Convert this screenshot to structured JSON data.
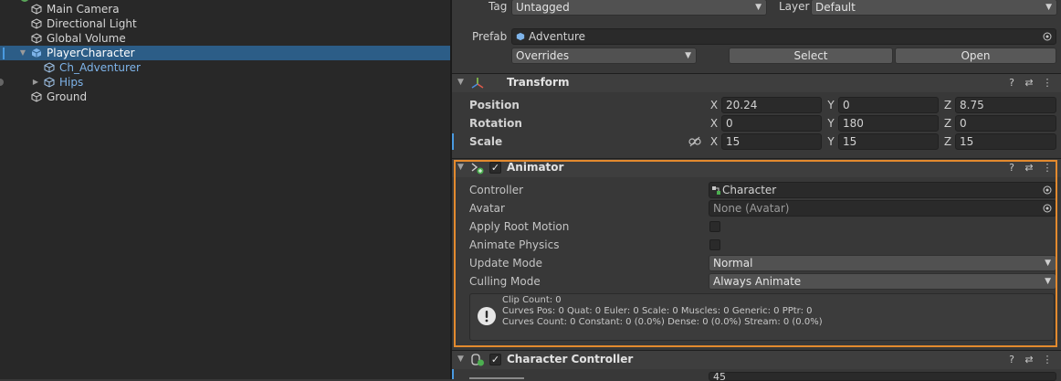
{
  "hierarchy": {
    "items": [
      {
        "label": "Main Camera"
      },
      {
        "label": "Directional Light"
      },
      {
        "label": "Global Volume"
      },
      {
        "label": "PlayerCharacter"
      },
      {
        "label": "Ch_Adventurer"
      },
      {
        "label": "Hips"
      },
      {
        "label": "Ground"
      }
    ]
  },
  "inspector": {
    "tag_label": "Tag",
    "tag_value": "Untagged",
    "layer_label": "Layer",
    "layer_value": "Default",
    "prefab_label": "Prefab",
    "prefab_value": "Adventure",
    "overrides_value": "Overrides",
    "select_button": "Select",
    "open_button": "Open",
    "transform": {
      "title": "Transform",
      "position_label": "Position",
      "rotation_label": "Rotation",
      "scale_label": "Scale",
      "axis_x": "X",
      "axis_y": "Y",
      "axis_z": "Z",
      "position": {
        "x": "20.24",
        "y": "0",
        "z": "8.75"
      },
      "rotation": {
        "x": "0",
        "y": "180",
        "z": "0"
      },
      "scale": {
        "x": "15",
        "y": "15",
        "z": "15"
      }
    },
    "animator": {
      "title": "Animator",
      "controller_label": "Controller",
      "controller_value": "Character",
      "avatar_label": "Avatar",
      "avatar_value": "None (Avatar)",
      "apply_root_motion_label": "Apply Root Motion",
      "animate_physics_label": "Animate Physics",
      "update_mode_label": "Update Mode",
      "update_mode_value": "Normal",
      "culling_mode_label": "Culling Mode",
      "culling_mode_value": "Always Animate",
      "info_line1": "Clip Count: 0",
      "info_line2": "Curves Pos: 0 Quat: 0 Euler: 0 Scale: 0 Muscles: 0 Generic: 0 PPtr: 0",
      "info_line3": "Curves Count: 0 Constant: 0 (0.0%) Dense: 0 (0.0%) Stream: 0 (0.0%)"
    },
    "character_controller": {
      "title": "Character Controller",
      "partial_value": "45"
    }
  },
  "colors": {
    "selection": "#2c5d87",
    "highlight_border": "#e38a2e",
    "child_text": "#7eb4ea"
  }
}
